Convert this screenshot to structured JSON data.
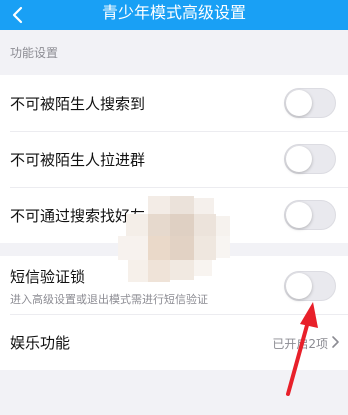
{
  "header": {
    "back_icon": "chevron-left-icon",
    "title": "青少年模式高级设置"
  },
  "section": {
    "title": "功能设置"
  },
  "settings": [
    {
      "label": "不可被陌生人搜索到",
      "toggle_on": false
    },
    {
      "label": "不可被陌生人拉进群",
      "toggle_on": false
    },
    {
      "label": "不可通过搜索找好友",
      "toggle_on": false
    }
  ],
  "sms_lock": {
    "label": "短信验证锁",
    "description": "进入高级设置或退出模式需进行短信验证",
    "toggle_on": false
  },
  "entertainment": {
    "label": "娱乐功能",
    "value": "已开启2项",
    "chevron_icon": "chevron-right-icon"
  },
  "colors": {
    "header_bg": "#19a0f5",
    "page_bg": "#f2f2f6",
    "annotation_arrow": "#e8202a"
  }
}
